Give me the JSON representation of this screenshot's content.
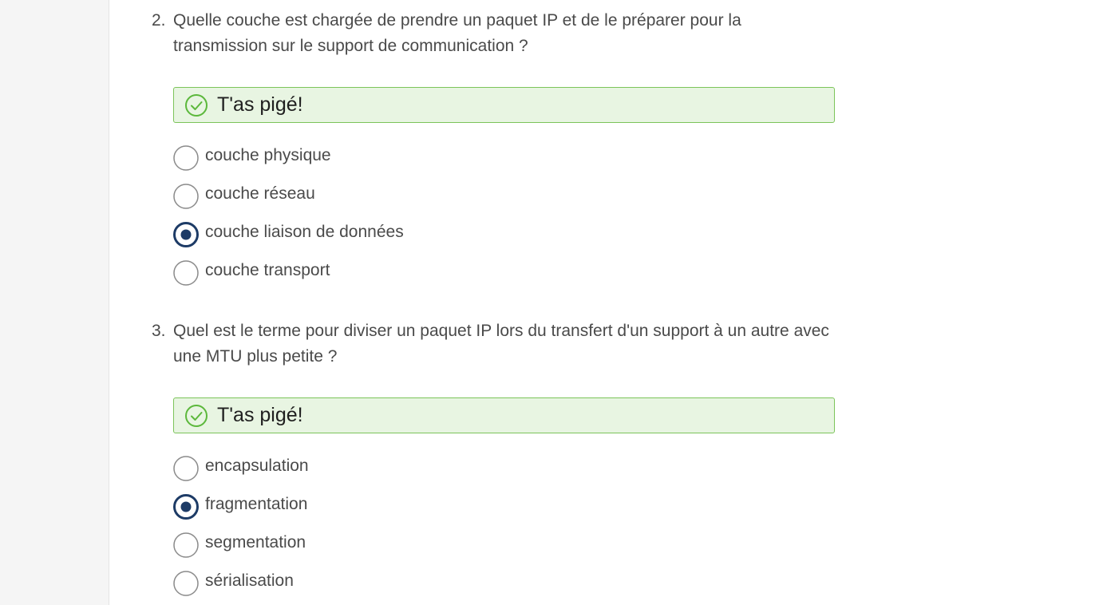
{
  "questions": [
    {
      "number": "2.",
      "text": "Quelle couche est chargée de prendre un paquet IP et de le préparer pour la transmission sur le support de communication ?",
      "feedback": "T'as pigé!",
      "options": [
        {
          "label": "couche physique",
          "selected": false
        },
        {
          "label": "couche réseau",
          "selected": false
        },
        {
          "label": "couche liaison de données",
          "selected": true
        },
        {
          "label": "couche transport",
          "selected": false
        }
      ]
    },
    {
      "number": "3.",
      "text": "Quel est le terme pour diviser un paquet IP lors du transfert d'un support à un autre avec une MTU plus petite ?",
      "feedback": "T'as pigé!",
      "options": [
        {
          "label": "encapsulation",
          "selected": false
        },
        {
          "label": "fragmentation",
          "selected": true
        },
        {
          "label": "segmentation",
          "selected": false
        },
        {
          "label": "sérialisation",
          "selected": false
        }
      ]
    }
  ],
  "colors": {
    "correct_border": "#7cc45a",
    "correct_bg": "#e8f5e2",
    "radio_selected": "#1d3b66",
    "radio_unselected": "#8a8a8a"
  },
  "icons": {
    "feedback": "check-circle-icon",
    "radio_on": "radio-selected-icon",
    "radio_off": "radio-unselected-icon"
  }
}
